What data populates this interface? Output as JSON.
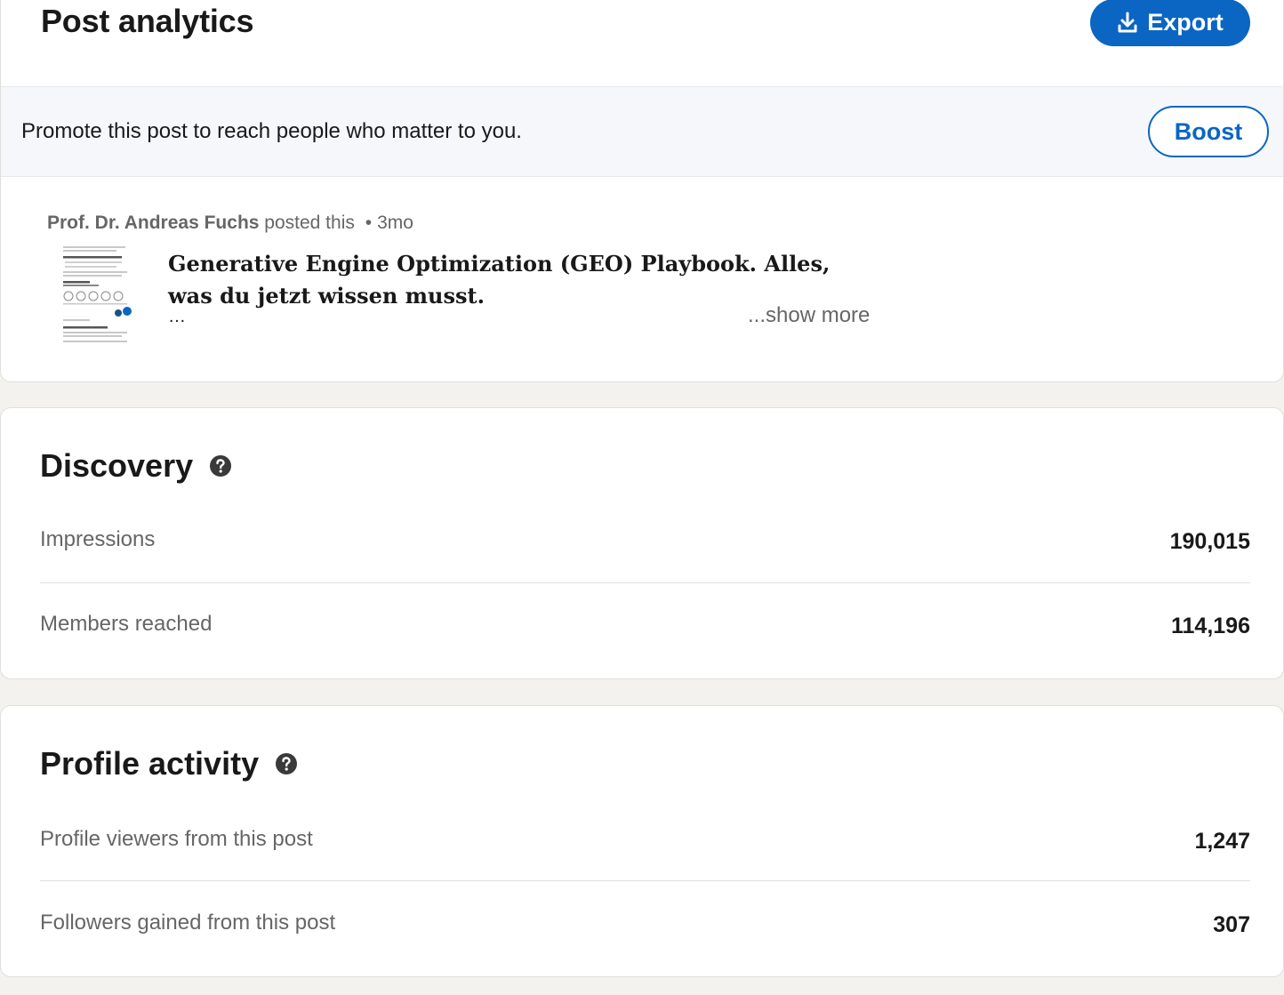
{
  "header": {
    "title": "Post analytics",
    "export_label": "Export",
    "export_icon": "download-icon",
    "accent_color": "#0a66c2"
  },
  "promo": {
    "text": "Promote this post to reach people who matter to you.",
    "boost_label": "Boost"
  },
  "post": {
    "author": "Prof. Dr. Andreas Fuchs",
    "action": "posted this",
    "separator": "•",
    "age": "3mo",
    "title": "Generative Engine Optimization (GEO) Playbook. Alles, was du jetzt wissen musst.",
    "ellipsis": "…",
    "show_more": "...show more"
  },
  "discovery": {
    "title": "Discovery",
    "help_icon": "help-circle-icon",
    "metrics": [
      {
        "label": "Impressions",
        "value": "190,015"
      },
      {
        "label": "Members reached",
        "value": "114,196"
      }
    ]
  },
  "profile_activity": {
    "title": "Profile activity",
    "help_icon": "help-circle-icon",
    "metrics": [
      {
        "label": "Profile viewers from this post",
        "value": "1,247"
      },
      {
        "label": "Followers gained from this post",
        "value": "307"
      }
    ]
  }
}
